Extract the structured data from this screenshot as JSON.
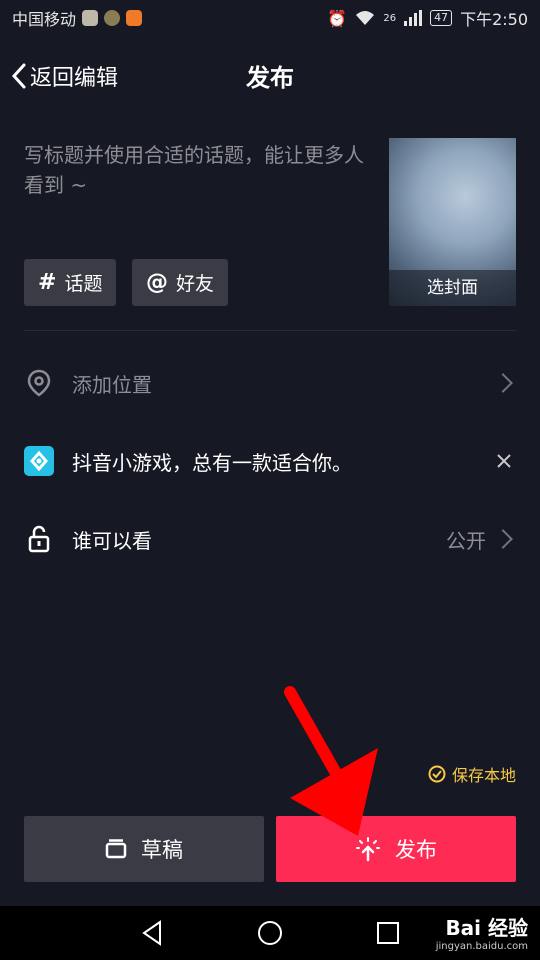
{
  "status_bar": {
    "carrier": "中国移动",
    "network": "26",
    "battery": "47",
    "time": "下午2:50"
  },
  "header": {
    "back_label": "返回编辑",
    "title": "发布"
  },
  "caption": {
    "placeholder": "写标题并使用合适的话题，能让更多人看到 ~"
  },
  "chips": [
    {
      "symbol": "#",
      "label": "话题"
    },
    {
      "symbol": "@",
      "label": "好友"
    }
  ],
  "cover": {
    "label": "选封面"
  },
  "rows": {
    "location": {
      "label": "添加位置"
    },
    "game": {
      "label": "抖音小游戏，总有一款适合你。"
    },
    "visibility": {
      "label": "谁可以看",
      "value": "公开"
    }
  },
  "save_local": {
    "label": "保存本地"
  },
  "buttons": {
    "draft": "草稿",
    "publish": "发布"
  },
  "watermark": {
    "brand": "Bai 经验",
    "url": "jingyan.baidu.com"
  },
  "colors": {
    "background": "#161823",
    "accent": "#fe2c55",
    "save_local": "#f7c945",
    "chip": "#3a3b45"
  }
}
